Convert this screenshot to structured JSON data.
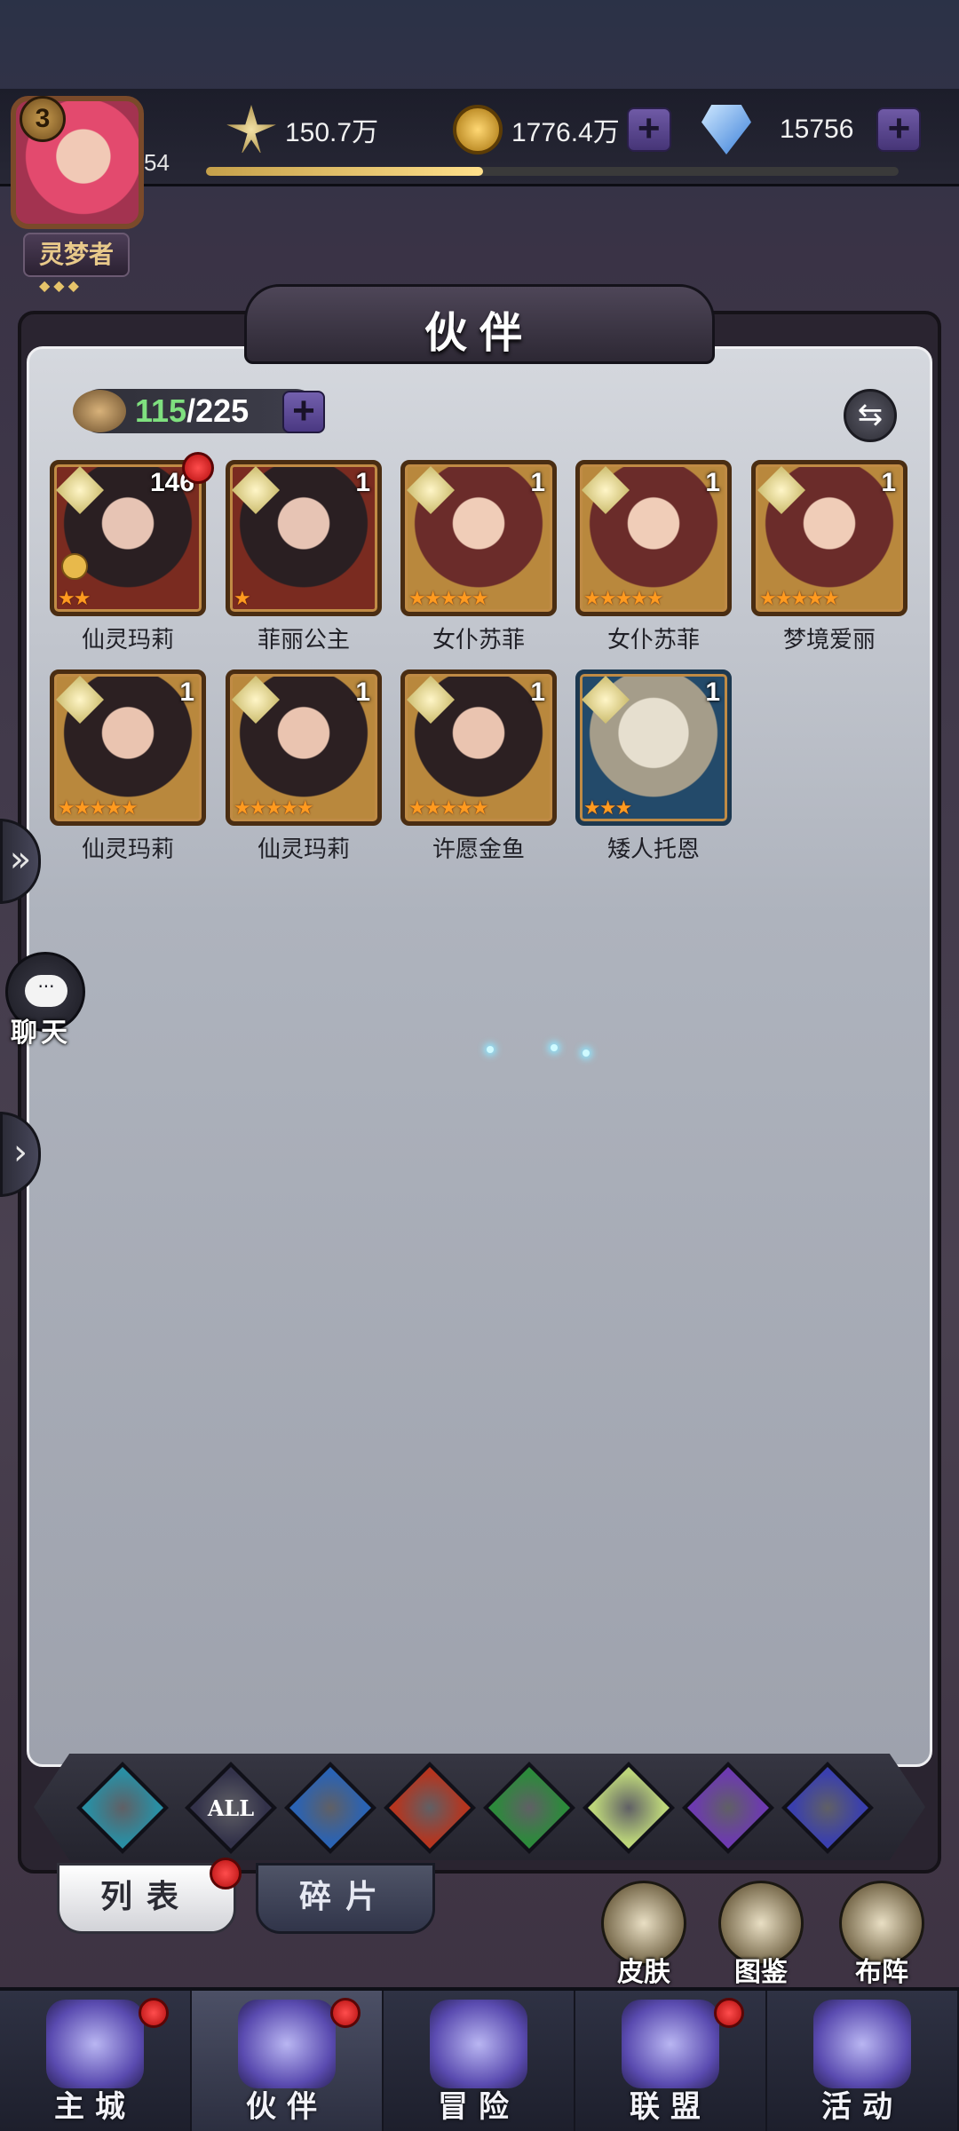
{
  "player": {
    "level": "3",
    "xp_level_label": "54",
    "title": "灵梦者",
    "title_stars": "◆◆◆",
    "xp_progress": 0.4
  },
  "resources": {
    "power": "150.7万",
    "gold": "1776.4万",
    "gems": "15756",
    "plus": "+"
  },
  "page": {
    "title": "伙伴"
  },
  "roster": {
    "current": "115",
    "capacity": "225",
    "separator": "/",
    "swap_icon": "⇆"
  },
  "heroes": [
    {
      "name": "仙灵玛莉",
      "level": "146",
      "stars": "★★",
      "frame": "red",
      "red_dot": true,
      "locked": true
    },
    {
      "name": "菲丽公主",
      "level": "1",
      "stars": "★",
      "frame": "red",
      "red_dot": false,
      "locked": false
    },
    {
      "name": "女仆苏菲",
      "level": "1",
      "stars": "★★★★★",
      "frame": "gold",
      "red_dot": false,
      "locked": false
    },
    {
      "name": "女仆苏菲",
      "level": "1",
      "stars": "★★★★★",
      "frame": "gold",
      "red_dot": false,
      "locked": false
    },
    {
      "name": "梦境爱丽",
      "level": "1",
      "stars": "★★★★★",
      "frame": "gold",
      "red_dot": false,
      "locked": false
    },
    {
      "name": "仙灵玛莉",
      "level": "1",
      "stars": "★★★★★",
      "frame": "dark",
      "red_dot": false,
      "locked": false
    },
    {
      "name": "仙灵玛莉",
      "level": "1",
      "stars": "★★★★★",
      "frame": "dark",
      "red_dot": false,
      "locked": false
    },
    {
      "name": "许愿金鱼",
      "level": "1",
      "stars": "★★★★★",
      "frame": "dark",
      "red_dot": false,
      "locked": false
    },
    {
      "name": "矮人托恩",
      "level": "1",
      "stars": "★★★",
      "frame": "blue",
      "red_dot": false,
      "locked": false
    }
  ],
  "side": {
    "chat_label": "聊天",
    "chat_bubble": "···",
    "expand_icon": "»",
    "arrow_icon": "›"
  },
  "element_filters": [
    {
      "name": "wind",
      "label": "",
      "color": "#2a8ea3"
    },
    {
      "name": "all",
      "label": "ALL",
      "color": "#33324a"
    },
    {
      "name": "water",
      "label": "",
      "color": "#2a63b4"
    },
    {
      "name": "fire",
      "label": "",
      "color": "#b5351f"
    },
    {
      "name": "nature",
      "label": "",
      "color": "#2c8a3b"
    },
    {
      "name": "light",
      "label": "",
      "color": "#bcd57a"
    },
    {
      "name": "dark",
      "label": "",
      "color": "#6d3ab0"
    },
    {
      "name": "cosmos",
      "label": "",
      "color": "#3a3fae"
    }
  ],
  "tabs": {
    "list": "列表",
    "fragments": "碎片"
  },
  "shortcuts": {
    "skin": "皮肤",
    "codex": "图鉴",
    "formation": "布阵"
  },
  "nav": [
    {
      "label": "主城",
      "dot": true,
      "active": false
    },
    {
      "label": "伙伴",
      "dot": true,
      "active": true
    },
    {
      "label": "冒险",
      "dot": false,
      "active": false
    },
    {
      "label": "联盟",
      "dot": true,
      "active": false
    },
    {
      "label": "活动",
      "dot": false,
      "active": false
    }
  ]
}
